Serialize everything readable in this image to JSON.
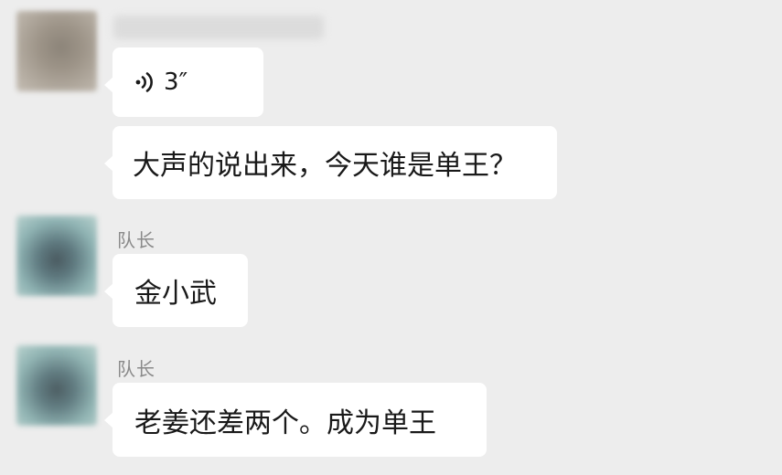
{
  "messages": [
    {
      "sender": "",
      "voice": {
        "duration": "3″"
      },
      "text": "大声的说出来，今天谁是单王？"
    },
    {
      "sender": "队长",
      "text": "金小武"
    },
    {
      "sender": "队长",
      "text": "老姜还差两个。成为单王"
    }
  ],
  "icons": {
    "voice": "voice-wave-icon"
  },
  "colors": {
    "background": "#ededed",
    "bubble": "#ffffff",
    "text": "#191919",
    "sender_name": "#8a8a8a"
  }
}
